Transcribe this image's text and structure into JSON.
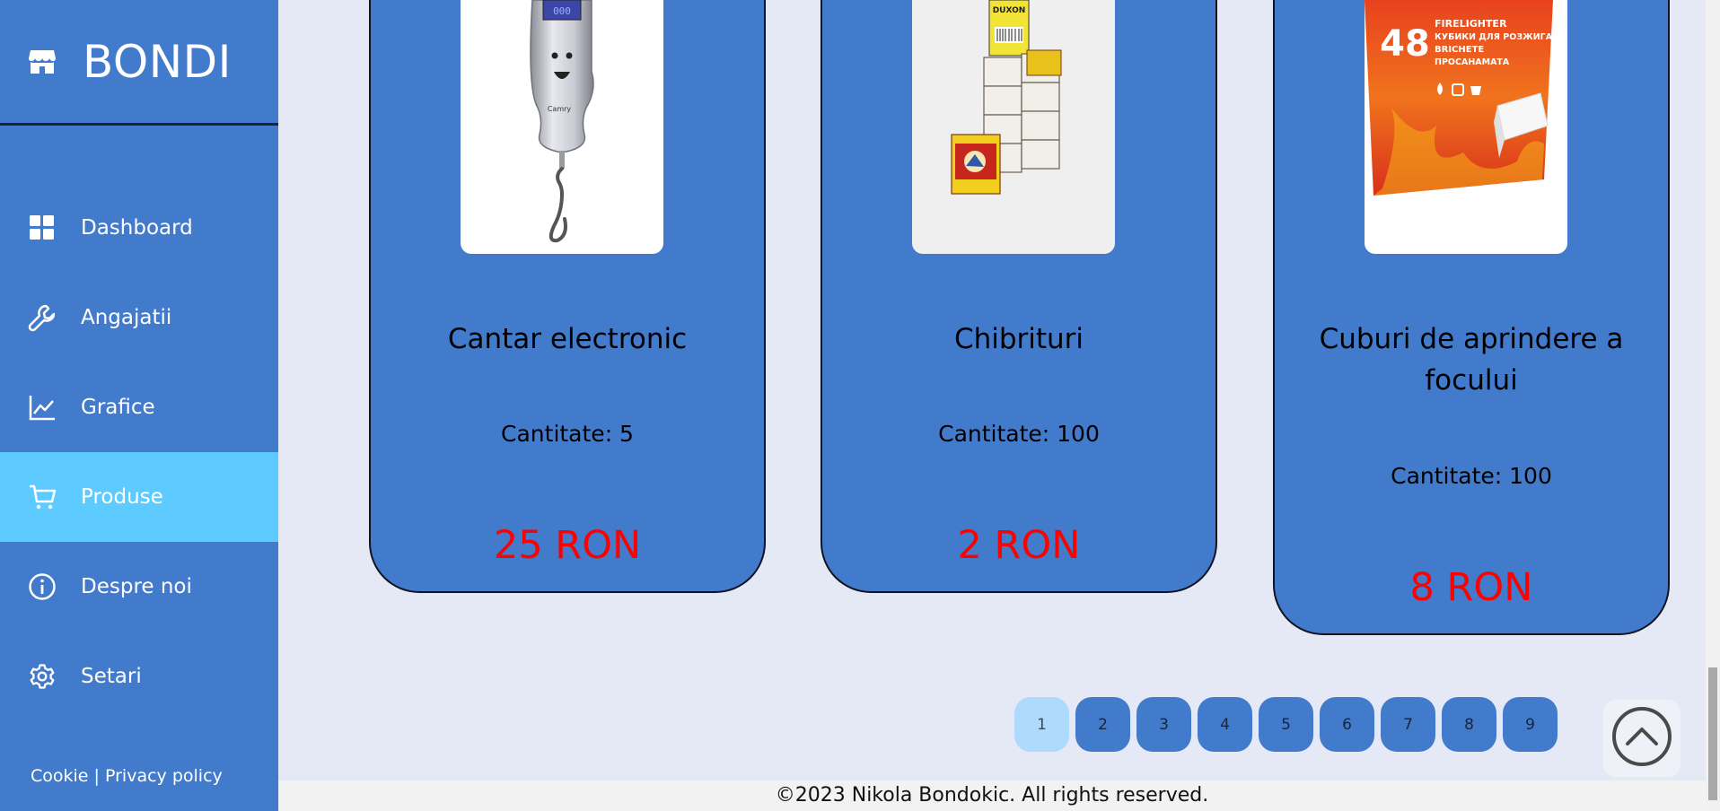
{
  "brand": {
    "name": "BONDI",
    "icon": "store-icon"
  },
  "nav": {
    "items": [
      {
        "label": "Dashboard",
        "icon": "dashboard-icon",
        "active": false
      },
      {
        "label": "Angajatii",
        "icon": "wrench-icon",
        "active": false
      },
      {
        "label": "Grafice",
        "icon": "chart-line-icon",
        "active": false
      },
      {
        "label": "Produse",
        "icon": "cart-icon",
        "active": true
      },
      {
        "label": "Despre noi",
        "icon": "info-icon",
        "active": false
      },
      {
        "label": "Setari",
        "icon": "gear-icon",
        "active": false
      }
    ]
  },
  "legal": {
    "cookie": "Cookie",
    "separator": "|",
    "privacy": "Privacy policy"
  },
  "products": [
    {
      "title": "Cantar electronic",
      "qty": "Cantitate: 5",
      "price": "25 RON"
    },
    {
      "title": "Chibrituri",
      "qty": "Cantitate: 100",
      "price": "2 RON"
    },
    {
      "title": "Cuburi de aprindere a focului",
      "qty": "Cantitate: 100",
      "price": "8 RON",
      "image_text": {
        "count": "48",
        "line1": "FIRELIGHTER",
        "line2": "КУБИКИ ДЛЯ РОЗЖИГА",
        "line3": "BRICHETE",
        "line4": "ПРОСАНАМАТА"
      }
    }
  ],
  "matchbox_label": "DUXON",
  "pagination": {
    "pages": [
      "1",
      "2",
      "3",
      "4",
      "5",
      "6",
      "7",
      "8",
      "9"
    ],
    "current": "1"
  },
  "footer": {
    "text": "©2023 Nikola Bondokic. All rights reserved."
  },
  "colors": {
    "sidebar": "#427bcb",
    "active": "#5dcbff",
    "price": "#ff0000",
    "background": "#e4e9f5"
  }
}
